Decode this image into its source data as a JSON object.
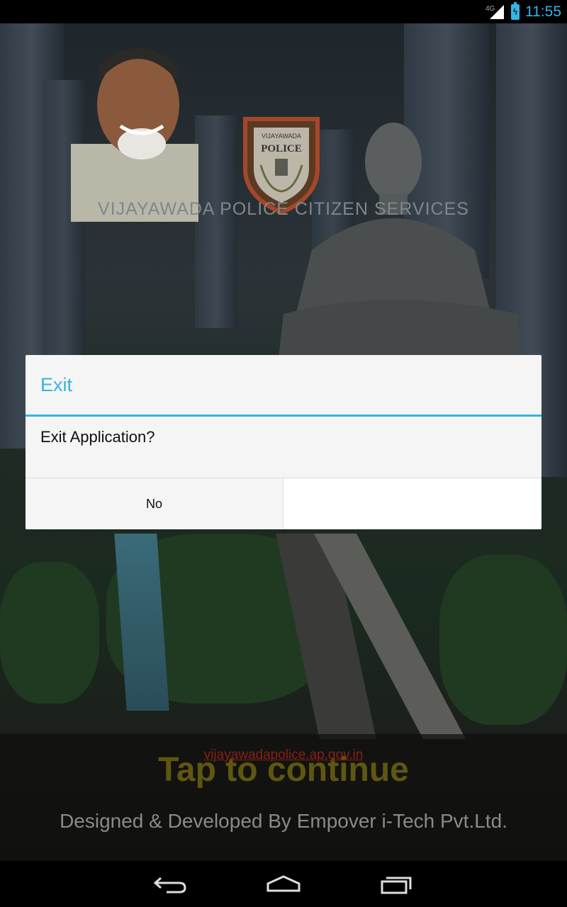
{
  "status_bar": {
    "network": "4G",
    "time": "11:55",
    "icons": [
      "signal-icon",
      "battery-charging-icon"
    ]
  },
  "background": {
    "title": "VIJAYAWADA POLICE CITIZEN SERVICES",
    "crest_text_top": "VIJAYAWADA",
    "crest_text_main": "POLICE",
    "url": "vijayawadapolice.ap.gov.in",
    "tap_label": "Tap to continue",
    "credit": "Designed & Developed By  Empover i-Tech Pvt.Ltd."
  },
  "dialog": {
    "title": "Exit",
    "message": "Exit Application?",
    "negative_button": "No",
    "positive_button": ""
  },
  "nav_bar": {
    "icons": [
      "back-icon",
      "home-icon",
      "recent-apps-icon"
    ]
  },
  "colors": {
    "accent": "#33b5e5",
    "dialog_bg": "#f5f5f5"
  }
}
